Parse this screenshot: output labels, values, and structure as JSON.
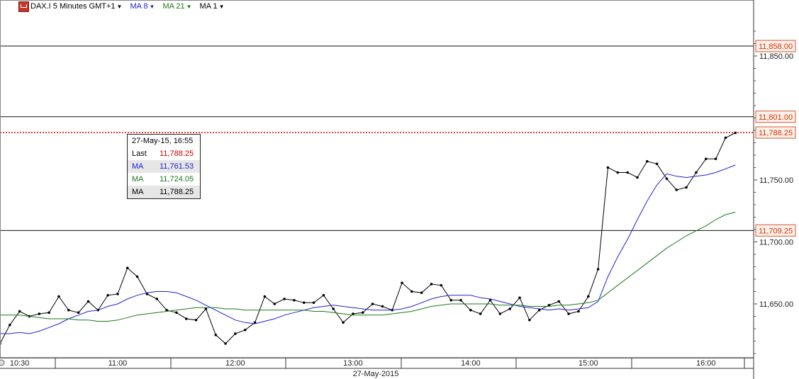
{
  "header": {
    "instrument": "DAX.I 5 Minutes GMT+1",
    "indicators": [
      {
        "label": "MA 8",
        "color": "#2222cc"
      },
      {
        "label": "MA 21",
        "color": "#1a7a1a"
      },
      {
        "label": "MA 1",
        "color": "#000000"
      }
    ],
    "caret_icon": "▼"
  },
  "tooltip": {
    "title": "27-May-15, 16:55",
    "rows": [
      {
        "key": "Last",
        "value": "11,788.25",
        "color": "#cc0000"
      },
      {
        "key": "MA",
        "value": "11,761.53",
        "color": "#2222cc"
      },
      {
        "key": "MA",
        "value": "11,724.05",
        "color": "#1a7a1a"
      },
      {
        "key": "MA",
        "value": "11,788.25",
        "color": "#000000"
      }
    ]
  },
  "chart_data": {
    "type": "line",
    "x_tick_labels": [
      "10:30",
      "11:00",
      "12:00",
      "13:00",
      "14:00",
      "15:00",
      "16:00"
    ],
    "x_tick_bar": [
      9.67,
      10.5,
      11.5,
      12.5,
      13.5,
      14.5,
      15.5
    ],
    "date_label": "27-May-2015",
    "y_ticks": [
      11650,
      11700,
      11750,
      11850
    ],
    "y_tick_labels": [
      "11,650.00",
      "11,700.00",
      "11,750.00",
      "11,850.00"
    ],
    "y_range": [
      11598,
      11875
    ],
    "price_levels": [
      {
        "value": 11858.0,
        "label": "11,858.00",
        "style": "solid"
      },
      {
        "value": 11801.0,
        "label": "11,801.00",
        "style": "solid"
      },
      {
        "value": 11788.25,
        "label": "11,788.25",
        "style": "dotted-red"
      },
      {
        "value": 11709.25,
        "label": "11,709.25",
        "style": "solid"
      }
    ],
    "series": [
      {
        "color": "#000000",
        "points": [
          11618,
          11633,
          11644,
          11640,
          11642,
          11643,
          11656,
          11645,
          11643,
          11652,
          11645,
          11657,
          11658,
          11679,
          11672,
          11658,
          11654,
          11645,
          11643,
          11638,
          11637,
          11646,
          11625,
          11618,
          11626,
          11629,
          11635,
          11656,
          11650,
          11654,
          11653,
          11651,
          11651,
          11657,
          11646,
          11635,
          11642,
          11643,
          11650,
          11648,
          11645,
          11667,
          11660,
          11659,
          11666,
          11665,
          11653,
          11653,
          11645,
          11642,
          11653,
          11642,
          11646,
          11655,
          11637,
          11645,
          11649,
          11652,
          11642,
          11644,
          11656,
          11678,
          11760,
          11756,
          11756,
          11752,
          11765,
          11763,
          11751,
          11742,
          11744,
          11756,
          11767,
          11767,
          11784,
          11788
        ]
      },
      {
        "color": "#2222cc",
        "points": [
          11626,
          11626,
          11627,
          11626,
          11628,
          11631,
          11634,
          11638,
          11641,
          11644,
          11645,
          11648,
          11650,
          11654,
          11657,
          11659,
          11660,
          11660,
          11659,
          11656,
          11653,
          11649,
          11645,
          11641,
          11637,
          11635,
          11634,
          11636,
          11638,
          11641,
          11643,
          11645,
          11647,
          11648,
          11649,
          11648,
          11647,
          11646,
          11645,
          11645,
          11645,
          11646,
          11648,
          11651,
          11654,
          11656,
          11657,
          11657,
          11657,
          11655,
          11654,
          11652,
          11650,
          11648,
          11647,
          11646,
          11645,
          11646,
          11645,
          11646,
          11647,
          11652,
          11672,
          11688,
          11702,
          11718,
          11733,
          11746,
          11755,
          11753,
          11752,
          11753,
          11754,
          11756,
          11759,
          11762
        ]
      },
      {
        "color": "#1a7a1a",
        "points": [
          11641,
          11641,
          11641,
          11640,
          11639,
          11638,
          11638,
          11638,
          11637,
          11637,
          11636,
          11636,
          11637,
          11639,
          11641,
          11642,
          11643,
          11644,
          11645,
          11646,
          11647,
          11647,
          11647,
          11646,
          11646,
          11645,
          11645,
          11645,
          11645,
          11645,
          11645,
          11645,
          11644,
          11644,
          11643,
          11642,
          11641,
          11641,
          11641,
          11641,
          11642,
          11643,
          11644,
          11646,
          11648,
          11649,
          11650,
          11650,
          11650,
          11650,
          11650,
          11649,
          11649,
          11649,
          11648,
          11648,
          11648,
          11649,
          11649,
          11650,
          11651,
          11653,
          11659,
          11665,
          11671,
          11677,
          11683,
          11689,
          11695,
          11700,
          11705,
          11709,
          11713,
          11718,
          11722,
          11724
        ]
      }
    ]
  }
}
